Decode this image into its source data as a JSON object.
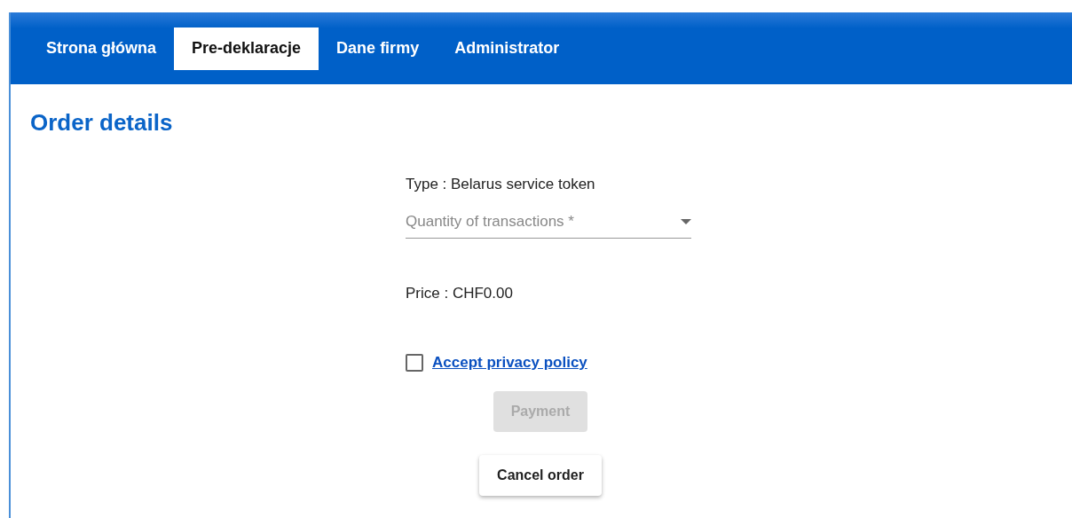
{
  "nav": {
    "tabs": [
      {
        "label": "Strona główna",
        "selected": false
      },
      {
        "label": "Pre-deklaracje",
        "selected": true
      },
      {
        "label": "Dane firmy",
        "selected": false
      },
      {
        "label": "Administrator",
        "selected": false
      }
    ]
  },
  "page": {
    "title": "Order details"
  },
  "form": {
    "type_text": "Type : Belarus service token",
    "quantity": {
      "placeholder": "Quantity of transactions *"
    },
    "price_text": "Price : CHF0.00",
    "privacy": {
      "checked": false,
      "link": "Accept privacy policy"
    },
    "payment_button": {
      "label": "Payment",
      "disabled": true
    },
    "cancel_button": {
      "label": "Cancel order"
    }
  }
}
